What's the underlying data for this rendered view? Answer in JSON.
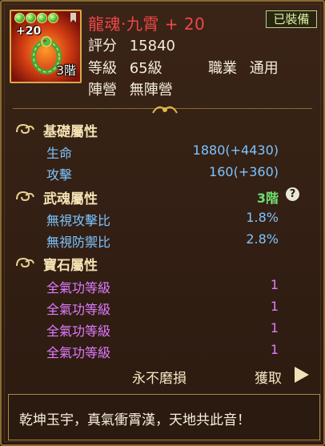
{
  "item": {
    "name": "龍魂·九霄",
    "enhance": "+ 20",
    "icon_enhance": "+20",
    "icon_tier": "3階",
    "equipped_badge": "已裝備",
    "score_label": "評分",
    "score_value": "15840",
    "level_label": "等級",
    "level_value": "65級",
    "job_label": "職業",
    "job_value": "通用",
    "camp_label": "陣營",
    "camp_value": "無陣營",
    "gem_count": 4
  },
  "base_section": {
    "title": "基礎屬性",
    "rows": [
      {
        "label": "生命",
        "value": "1880(+4430)"
      },
      {
        "label": "攻擊",
        "value": "160(+360)"
      }
    ]
  },
  "soul_section": {
    "title": "武魂屬性",
    "tier": "3階",
    "help_icon": "?",
    "rows": [
      {
        "label": "無視攻擊比",
        "value": "1.8%"
      },
      {
        "label": "無視防禦比",
        "value": "2.8%"
      }
    ]
  },
  "gem_section": {
    "title": "寶石屬性",
    "rows": [
      {
        "label": "全氣功等級",
        "value": "1"
      },
      {
        "label": "全氣功等級",
        "value": "1"
      },
      {
        "label": "全氣功等級",
        "value": "1"
      },
      {
        "label": "全氣功等級",
        "value": "1"
      }
    ]
  },
  "footer": {
    "durability": "永不磨損",
    "obtain_label": "獲取",
    "flavor_text": "乾坤玉宇，真氣衝霄漢，天地共此音！"
  },
  "colors": {
    "title": "#ef4747",
    "attr_blue": "#7cc4ff",
    "attr_magenta": "#df7bff",
    "tier_green": "#6fe06f",
    "frame_gold": "#8a6a2e"
  }
}
